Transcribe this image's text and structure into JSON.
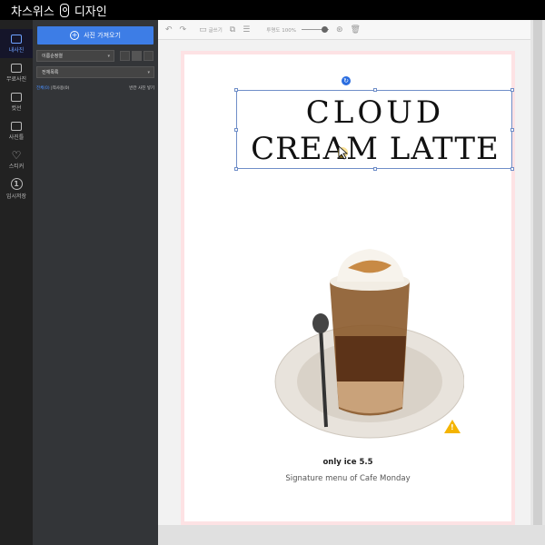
{
  "app": {
    "title_part1": "차스위스",
    "title_part2": "디자인"
  },
  "rail": {
    "items": [
      {
        "label": "내사진",
        "icon": "photo-icon"
      },
      {
        "label": "무료사진",
        "icon": "free-photo-icon"
      },
      {
        "label": "컷선",
        "icon": "cut-line-icon"
      },
      {
        "label": "사진틀",
        "icon": "frame-icon"
      },
      {
        "label": "스티커",
        "icon": "heart-icon"
      },
      {
        "label": "임시저장",
        "icon": "temp-save-icon"
      }
    ]
  },
  "panel": {
    "upload_label": "사진 가져오기",
    "sort_select": "이름순정렬",
    "folder_select": "전체목록",
    "filter_all": "전체(0)",
    "filter_used": "|적사용(0)",
    "filter_right": "빈칸 사진 넣기"
  },
  "toolbar": {
    "copy_label": "글쓰기",
    "zoom_label": "투명도 100%",
    "zoom_level": 0.85
  },
  "canvas": {
    "title_line1": "CLOUD",
    "title_line2": "CREAM LATTE",
    "price": "only ice 5.5",
    "signature": "Signature menu of Cafe Monday"
  },
  "colors": {
    "accent": "#3d7de6",
    "page_border": "#fde2e4",
    "warning": "#f4b400"
  }
}
